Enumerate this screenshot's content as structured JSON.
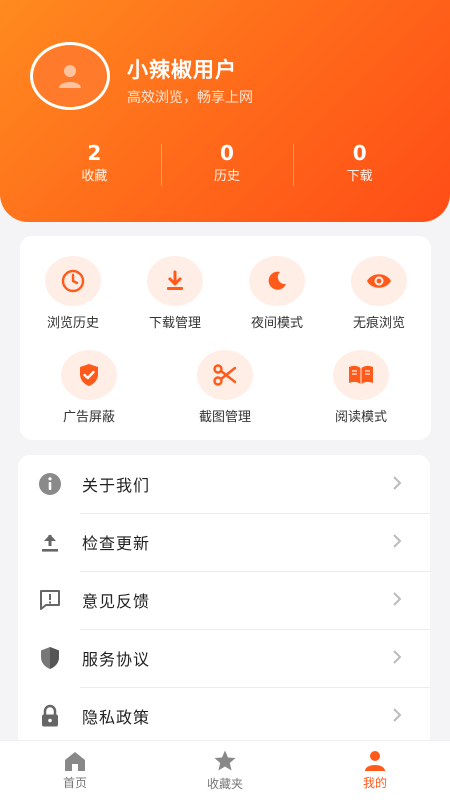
{
  "profile": {
    "username": "小辣椒用户",
    "tagline": "高效浏览，畅享上网",
    "avatar_icon": "user-icon"
  },
  "stats": [
    {
      "value": "2",
      "label": "收藏"
    },
    {
      "value": "0",
      "label": "历史"
    },
    {
      "value": "0",
      "label": "下载"
    }
  ],
  "tools": [
    {
      "label": "浏览历史",
      "icon": "clock-icon"
    },
    {
      "label": "下载管理",
      "icon": "download-icon"
    },
    {
      "label": "夜间模式",
      "icon": "moon-icon"
    },
    {
      "label": "无痕浏览",
      "icon": "eye-icon"
    },
    {
      "label": "广告屏蔽",
      "icon": "shield-check-icon"
    },
    {
      "label": "截图管理",
      "icon": "scissors-icon"
    },
    {
      "label": "阅读模式",
      "icon": "book-icon"
    }
  ],
  "menu": [
    {
      "label": "关于我们",
      "icon": "info-icon"
    },
    {
      "label": "检查更新",
      "icon": "upload-icon"
    },
    {
      "label": "意见反馈",
      "icon": "feedback-icon"
    },
    {
      "label": "服务协议",
      "icon": "shield-icon"
    },
    {
      "label": "隐私政策",
      "icon": "lock-icon"
    }
  ],
  "nav": [
    {
      "label": "首页",
      "icon": "home-icon",
      "active": false
    },
    {
      "label": "收藏夹",
      "icon": "star-icon",
      "active": false
    },
    {
      "label": "我的",
      "icon": "person-icon",
      "active": true
    }
  ],
  "colors": {
    "accent": "#ff5a1a",
    "header_start": "#ff8a1f",
    "header_end": "#ff4d17",
    "tool_bg": "#ffeee6"
  }
}
